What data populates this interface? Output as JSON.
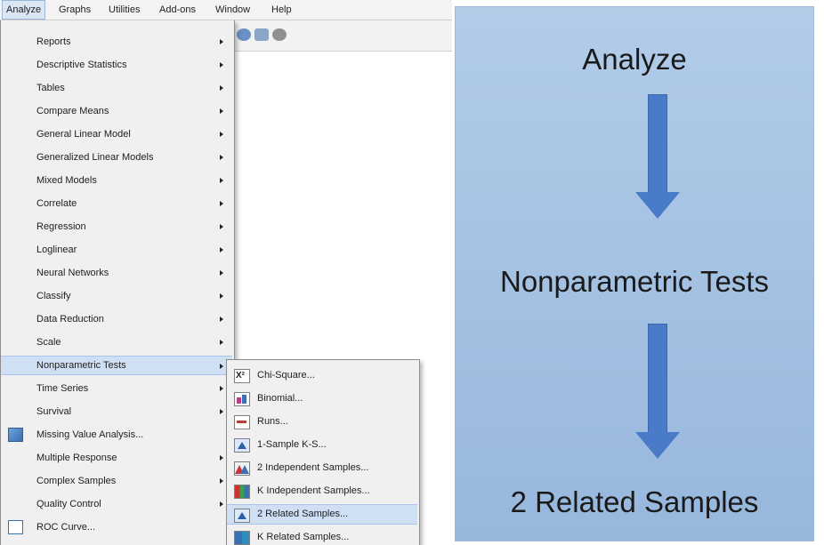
{
  "menubar": {
    "items": [
      "Analyze",
      "Graphs",
      "Utilities",
      "Add-ons",
      "Window",
      "Help"
    ]
  },
  "analyze_menu": {
    "items": [
      {
        "label": "Reports",
        "submenu": true
      },
      {
        "label": "Descriptive Statistics",
        "submenu": true
      },
      {
        "label": "Tables",
        "submenu": true
      },
      {
        "label": "Compare Means",
        "submenu": true
      },
      {
        "label": "General Linear Model",
        "submenu": true
      },
      {
        "label": "Generalized Linear Models",
        "submenu": true
      },
      {
        "label": "Mixed Models",
        "submenu": true
      },
      {
        "label": "Correlate",
        "submenu": true
      },
      {
        "label": "Regression",
        "submenu": true
      },
      {
        "label": "Loglinear",
        "submenu": true
      },
      {
        "label": "Neural Networks",
        "submenu": true
      },
      {
        "label": "Classify",
        "submenu": true
      },
      {
        "label": "Data Reduction",
        "submenu": true
      },
      {
        "label": "Scale",
        "submenu": true
      },
      {
        "label": "Nonparametric Tests",
        "submenu": true
      },
      {
        "label": "Time Series",
        "submenu": true
      },
      {
        "label": "Survival",
        "submenu": true
      },
      {
        "label": "Missing Value Analysis...",
        "submenu": false
      },
      {
        "label": "Multiple Response",
        "submenu": true
      },
      {
        "label": "Complex Samples",
        "submenu": true
      },
      {
        "label": "Quality Control",
        "submenu": true
      },
      {
        "label": "ROC Curve...",
        "submenu": false
      }
    ]
  },
  "nonparametric_submenu": {
    "items": [
      {
        "label": "Chi-Square...",
        "icon": "chi-square-icon"
      },
      {
        "label": "Binomial...",
        "icon": "binomial-icon"
      },
      {
        "label": "Runs...",
        "icon": "runs-icon"
      },
      {
        "label": "1-Sample K-S...",
        "icon": "one-sample-ks-icon"
      },
      {
        "label": "2 Independent Samples...",
        "icon": "two-independent-samples-icon"
      },
      {
        "label": "K Independent Samples...",
        "icon": "k-independent-samples-icon"
      },
      {
        "label": "2 Related Samples...",
        "icon": "two-related-samples-icon"
      },
      {
        "label": "K Related Samples...",
        "icon": "k-related-samples-icon"
      }
    ]
  },
  "flow": {
    "step1": "Analyze",
    "step2": "Nonparametric Tests",
    "step3": "2 Related Samples",
    "arrow_color": "#4a7bc8",
    "panel_color": "#a8c4e4"
  }
}
